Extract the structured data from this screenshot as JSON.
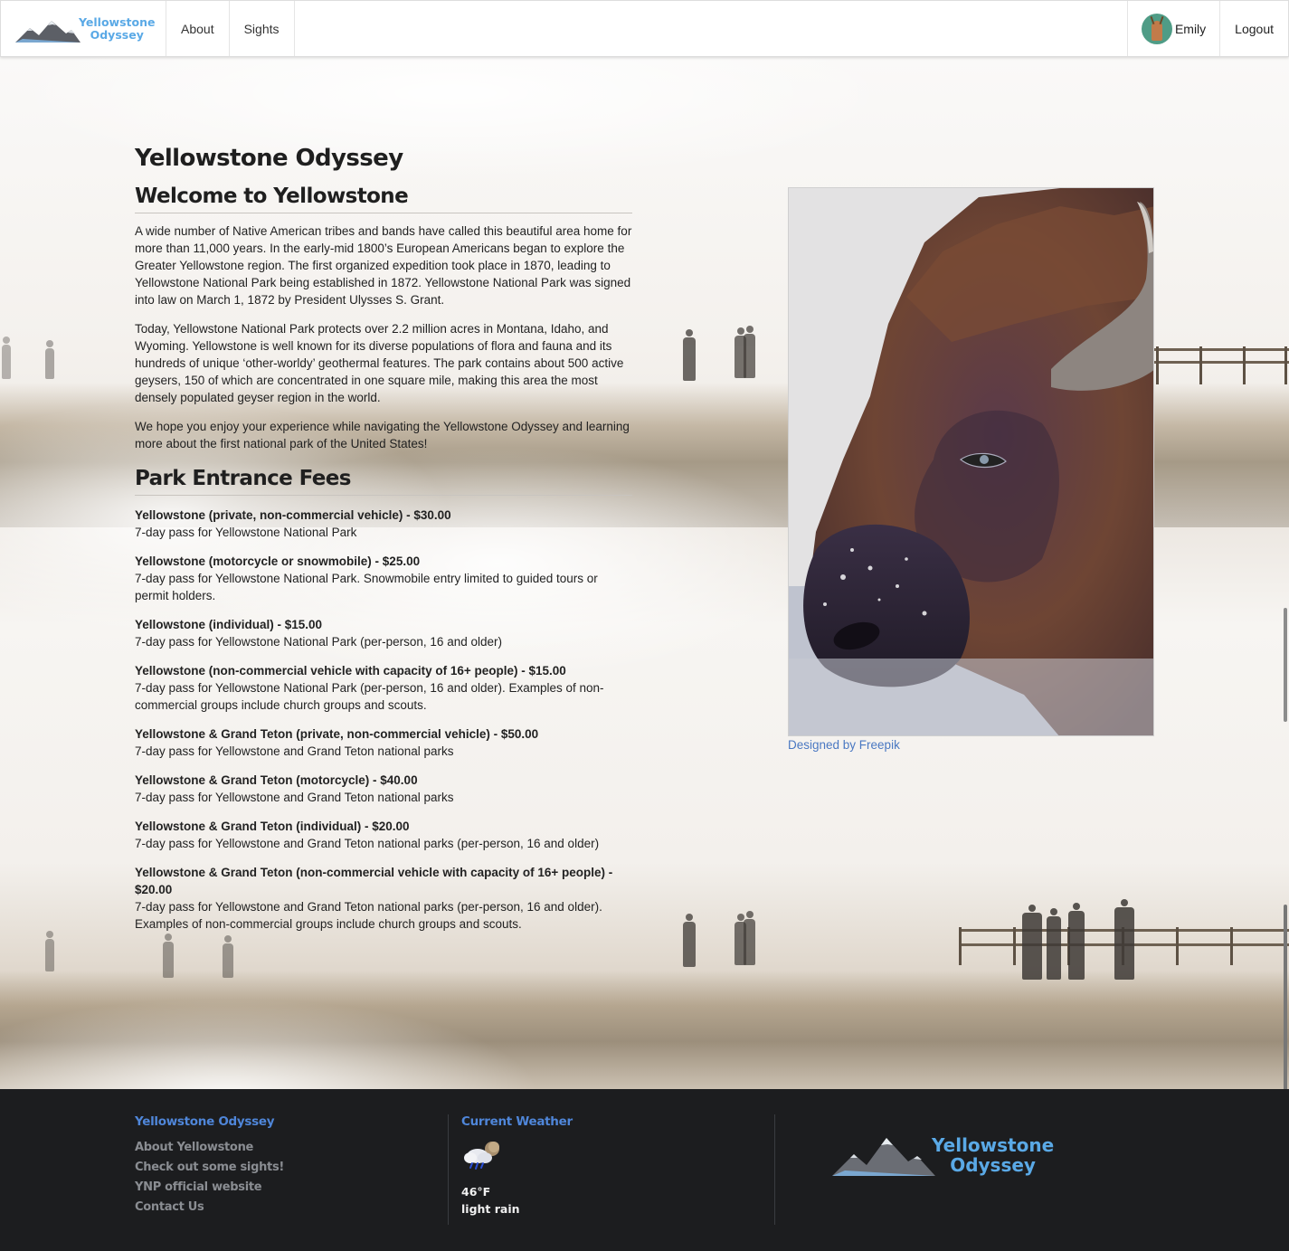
{
  "nav": {
    "brand_line1": "Yellowstone",
    "brand_line2": "Odyssey",
    "links": [
      "About",
      "Sights"
    ],
    "user_name": "Emily",
    "logout_label": "Logout"
  },
  "main": {
    "page_title": "Yellowstone Odyssey",
    "welcome_heading": "Welcome to Yellowstone",
    "paragraphs": [
      "A wide number of Native American tribes and bands have called this beautiful area home for more than 11,000 years. In the early-mid 1800’s European Americans began to explore the Greater Yellowstone region. The first organized expedition took place in 1870, leading to Yellowstone National Park being established in 1872. Yellowstone National Park was signed into law on March 1, 1872 by President Ulysses S. Grant.",
      "Today, Yellowstone National Park protects over 2.2 million acres in Montana, Idaho, and Wyoming. Yellowstone is well known for its diverse populations of flora and fauna and its hundreds of unique ‘other-worldy’ geothermal features. The park contains about 500 active geysers, 150 of which are concentrated in one square mile, making this area the most densely populated geyser region in the world.",
      "We hope you enjoy your experience while navigating the Yellowstone Odyssey and learning more about the first national park of the United States!"
    ],
    "fees_heading": "Park Entrance Fees",
    "fees": [
      {
        "title": "Yellowstone (private, non-commercial vehicle) - $30.00",
        "desc": "7-day pass for Yellowstone National Park"
      },
      {
        "title": "Yellowstone (motorcycle or snowmobile) - $25.00",
        "desc": "7-day pass for Yellowstone National Park. Snowmobile entry limited to guided tours or permit holders."
      },
      {
        "title": "Yellowstone (individual) - $15.00",
        "desc": "7-day pass for Yellowstone National Park (per-person, 16 and older)"
      },
      {
        "title": "Yellowstone (non-commercial vehicle with capacity of 16+ people) - $15.00",
        "desc": "7-day pass for Yellowstone National Park (per-person, 16 and older). Examples of non-commercial groups include church groups and scouts."
      },
      {
        "title": "Yellowstone & Grand Teton (private, non-commercial vehicle) - $50.00",
        "desc": "7-day pass for Yellowstone and Grand Teton national parks"
      },
      {
        "title": "Yellowstone & Grand Teton (motorcycle) - $40.00",
        "desc": "7-day pass for Yellowstone and Grand Teton national parks"
      },
      {
        "title": "Yellowstone & Grand Teton (individual) - $20.00",
        "desc": "7-day pass for Yellowstone and Grand Teton national parks (per-person, 16 and older)"
      },
      {
        "title": "Yellowstone & Grand Teton (non-commercial vehicle with capacity of 16+ people) - $20.00",
        "desc": "7-day pass for Yellowstone and Grand Teton national parks (per-person, 16 and older). Examples of non-commercial groups include church groups and scouts."
      }
    ],
    "image_credit": "Designed by Freepik"
  },
  "footer": {
    "col1_title": "Yellowstone Odyssey",
    "links": [
      "About Yellowstone",
      "Check out some sights!",
      "YNP official website",
      "Contact Us"
    ],
    "weather_title": "Current Weather",
    "weather_icon": "rain-cloud-icon",
    "temperature": "46°F",
    "conditions": "light rain",
    "logo_line1": "Yellowstone",
    "logo_line2": "Odyssey"
  },
  "colors": {
    "brand_blue": "#5aa9e6",
    "link_blue": "#4a78c2",
    "footer_bg": "#1c1d1f",
    "footer_title": "#4f86d9"
  }
}
